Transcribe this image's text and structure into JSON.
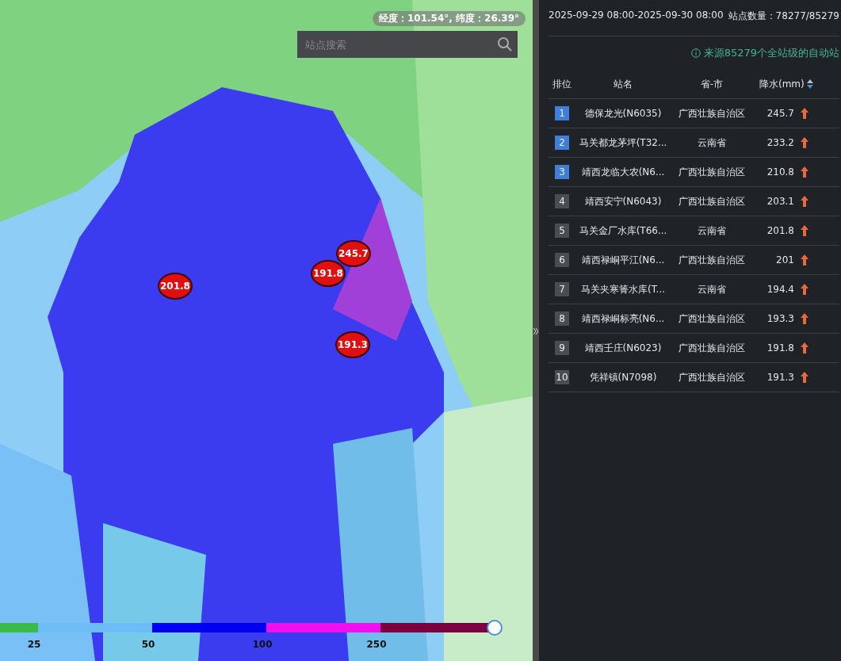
{
  "map": {
    "coordinates": "经度：101.54°, 纬度：26.39°",
    "search": {
      "placeholder": "站点搜索"
    },
    "markers": [
      {
        "value": "245.7"
      },
      {
        "value": "201.8"
      },
      {
        "value": "191.8"
      },
      {
        "value": "191.3"
      }
    ],
    "legend": [
      {
        "label": "25",
        "color": "#3dbb4a"
      },
      {
        "label": "50",
        "color": "#6cbcf5"
      },
      {
        "label": "100",
        "color": "#0000f0"
      },
      {
        "label": "250",
        "color": "#ee10ee"
      },
      {
        "color": "#7a0040"
      }
    ]
  },
  "panel": {
    "period": "2025-09-29 08:00-2025-09-30 08:00",
    "station_count": "站点数量：78277/85279",
    "source": "来源85279个全站级的自动站",
    "columns": [
      "排位",
      "站名",
      "省-市",
      "降水(mm)"
    ],
    "rows": [
      {
        "rank": "1",
        "top": true,
        "name": "德保龙光(N6035)",
        "region": "广西壮族自治区",
        "rain": "245.7"
      },
      {
        "rank": "2",
        "top": true,
        "name": "马关都龙茅坪(T32...",
        "region": "云南省",
        "rain": "233.2"
      },
      {
        "rank": "3",
        "top": true,
        "name": "靖西龙临大农(N6...",
        "region": "广西壮族自治区",
        "rain": "210.8"
      },
      {
        "rank": "4",
        "top": false,
        "name": "靖西安宁(N6043)",
        "region": "广西壮族自治区",
        "rain": "203.1"
      },
      {
        "rank": "5",
        "top": false,
        "name": "马关金厂水库(T66...",
        "region": "云南省",
        "rain": "201.8"
      },
      {
        "rank": "6",
        "top": false,
        "name": "靖西禄峒平江(N6...",
        "region": "广西壮族自治区",
        "rain": "201"
      },
      {
        "rank": "7",
        "top": false,
        "name": "马关夹寒箐水库(T...",
        "region": "云南省",
        "rain": "194.4"
      },
      {
        "rank": "8",
        "top": false,
        "name": "靖西禄峒标亮(N6...",
        "region": "广西壮族自治区",
        "rain": "193.3"
      },
      {
        "rank": "9",
        "top": false,
        "name": "靖西壬庄(N6023)",
        "region": "广西壮族自治区",
        "rain": "191.8"
      },
      {
        "rank": "10",
        "top": false,
        "name": "凭祥镇(N7098)",
        "region": "广西壮族自治区",
        "rain": "191.3"
      }
    ]
  }
}
